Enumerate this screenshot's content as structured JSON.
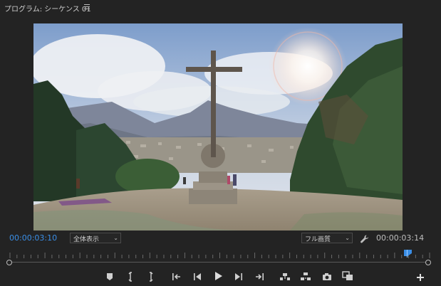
{
  "header": {
    "title": "プログラム: シーケンス 01",
    "menu_icon": "hamburger-menu-icon"
  },
  "viewer": {
    "content": "program-monitor-frame"
  },
  "controls": {
    "current_timecode": "00:00:03:10",
    "duration_timecode": "00:00:03:14",
    "zoom_label": "全体表示",
    "quality_label": "フル画質",
    "accent_color": "#3a8ee6"
  },
  "transport": {
    "buttons": [
      "add-marker-icon",
      "mark-in-icon",
      "mark-out-icon",
      "go-to-in-icon",
      "step-back-icon",
      "play-icon",
      "step-forward-icon",
      "go-to-out-icon",
      "lift-icon",
      "extract-icon",
      "export-frame-icon",
      "comparison-view-icon",
      "add-button-icon"
    ]
  }
}
